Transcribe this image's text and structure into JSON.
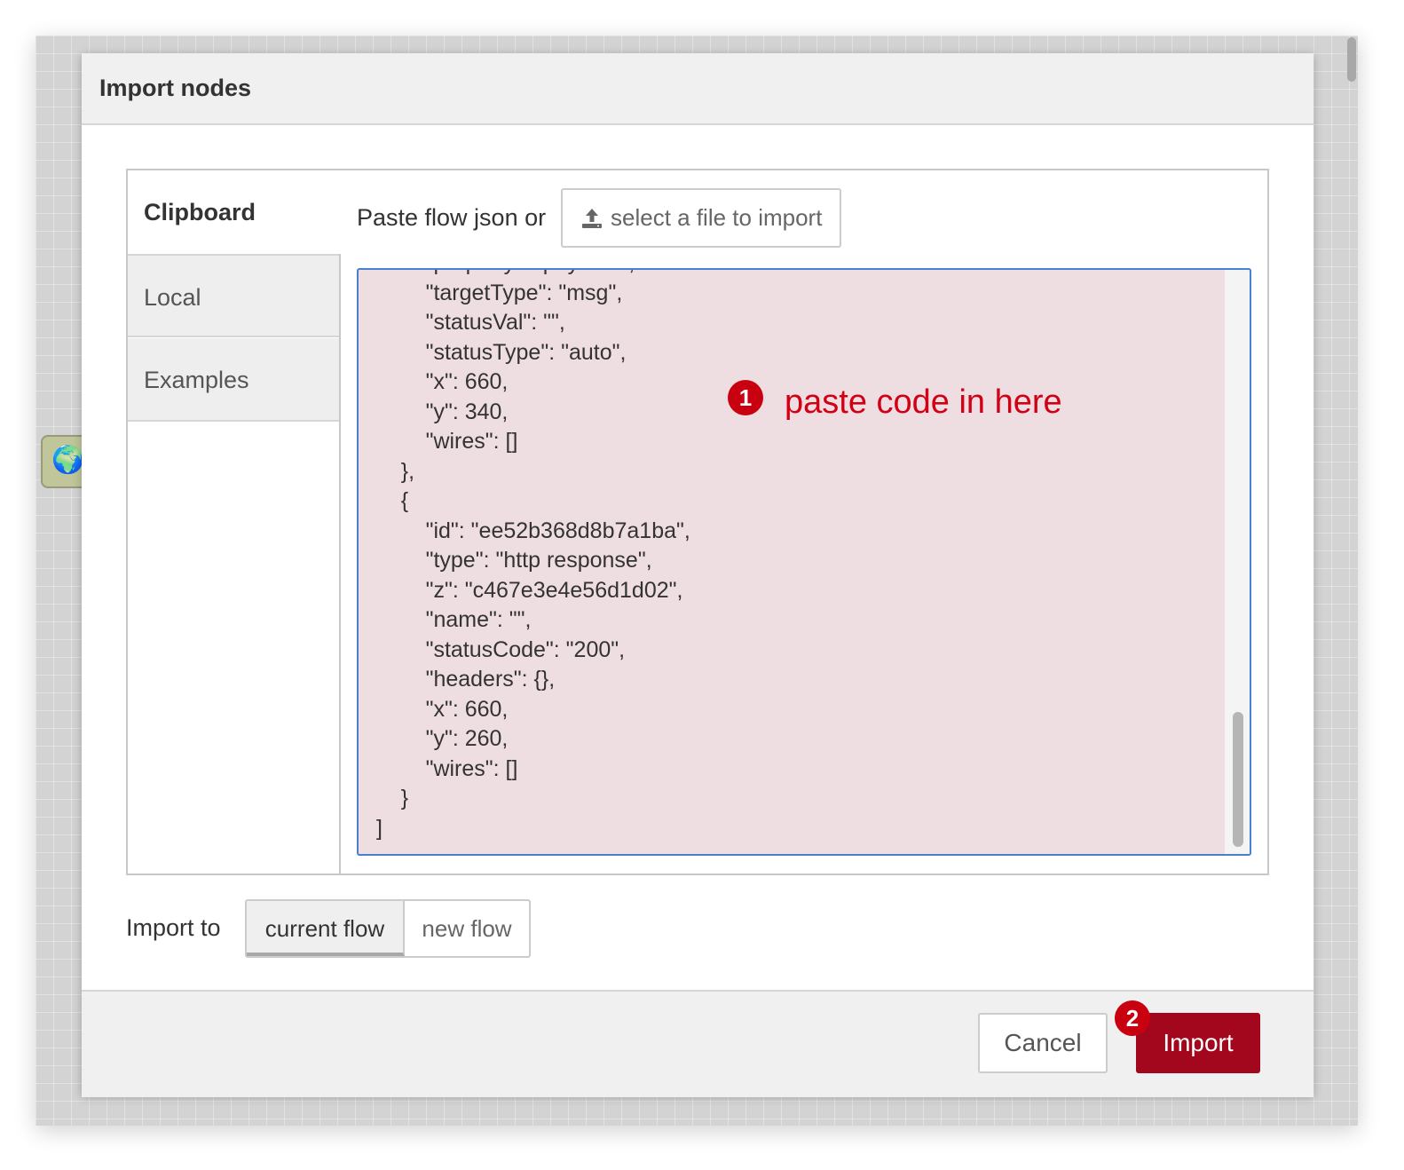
{
  "dialog": {
    "title": "Import nodes"
  },
  "sidebar": {
    "tabs": [
      {
        "label": "Clipboard",
        "active": true
      },
      {
        "label": "Local",
        "active": false
      },
      {
        "label": "Examples",
        "active": false
      }
    ]
  },
  "clipboard": {
    "paste_label": "Paste flow json or",
    "file_button_label": "select a file to import",
    "file_button_icon": "upload-icon",
    "json_text": "        \"property\": \"payload\",\n        \"targetType\": \"msg\",\n        \"statusVal\": \"\",\n        \"statusType\": \"auto\",\n        \"x\": 660,\n        \"y\": 340,\n        \"wires\": []\n    },\n    {\n        \"id\": \"ee52b368d8b7a1ba\",\n        \"type\": \"http response\",\n        \"z\": \"c467e3e4e56d1d02\",\n        \"name\": \"\",\n        \"statusCode\": \"200\",\n        \"headers\": {},\n        \"x\": 660,\n        \"y\": 260,\n        \"wires\": []\n    }\n]"
  },
  "annotations": {
    "step1_number": "1",
    "step1_text": "paste code in here",
    "step2_number": "2",
    "color": "#d10015"
  },
  "import_to": {
    "label": "Import to",
    "options": [
      {
        "label": "current flow",
        "selected": true
      },
      {
        "label": "new flow",
        "selected": false
      }
    ]
  },
  "footer": {
    "cancel_label": "Cancel",
    "import_label": "Import",
    "import_color": "#a3071d"
  },
  "background": {
    "node_icon": "globe-icon"
  }
}
